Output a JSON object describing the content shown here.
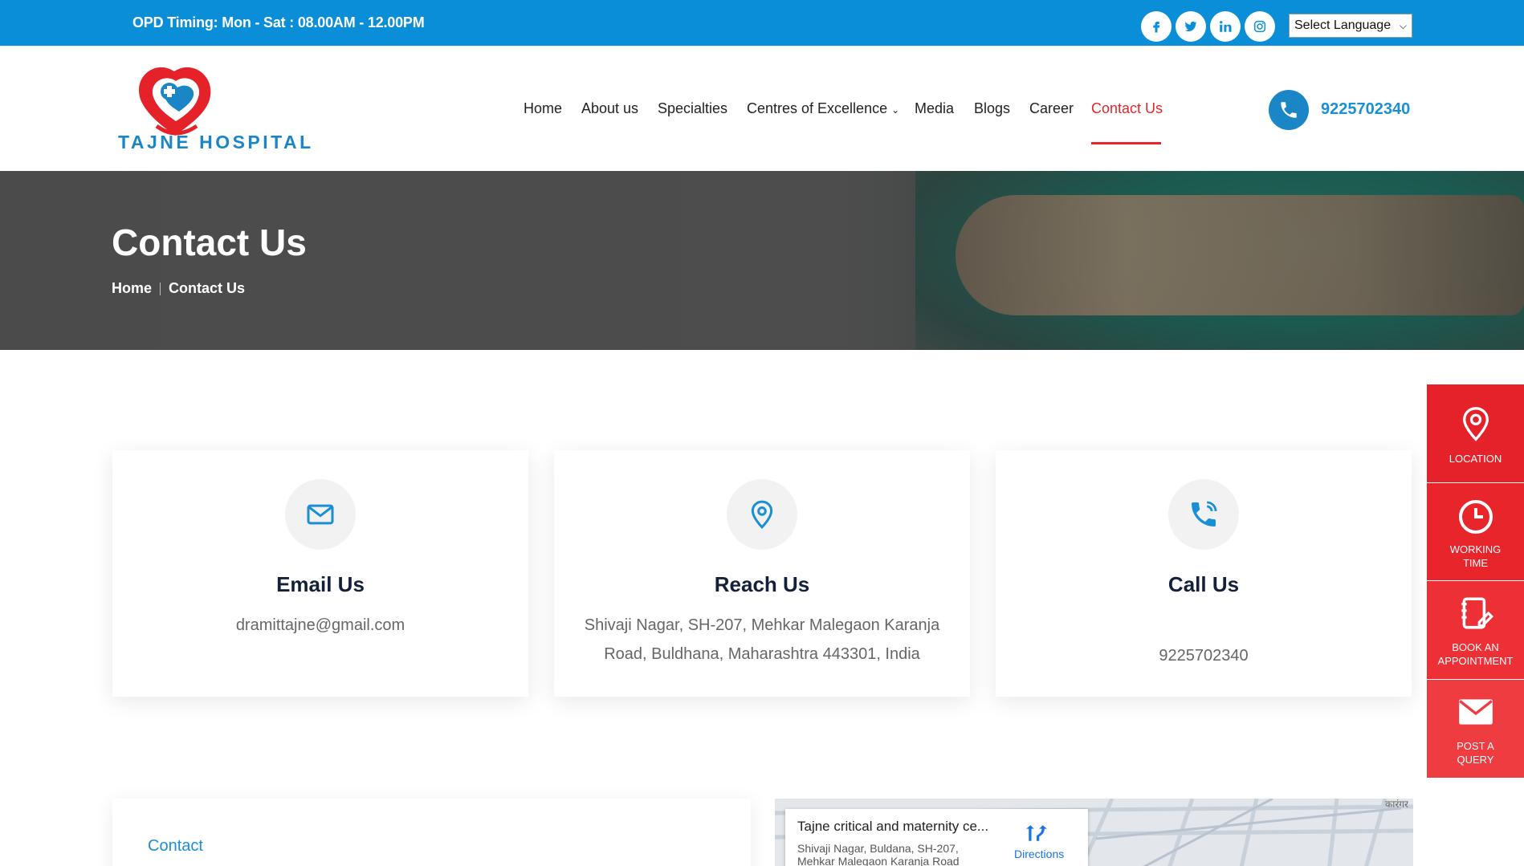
{
  "topbar": {
    "opd_timing": "OPD Timing: Mon - Sat : 08.00AM - 12.00PM",
    "social": [
      "facebook-icon",
      "twitter-icon",
      "linkedin-icon",
      "instagram-icon"
    ],
    "language_select": "Select Language"
  },
  "header": {
    "logo_text": "TAJNE HOSPITAL",
    "nav": [
      "Home",
      "About us",
      "Specialties",
      "Centres of Excellence",
      "Media",
      "Blogs",
      "Career",
      "Contact Us"
    ],
    "active_nav": "Contact Us",
    "phone": "9225702340"
  },
  "hero": {
    "title": "Contact Us",
    "breadcrumb": [
      "Home",
      "Contact Us"
    ]
  },
  "cards": [
    {
      "icon": "mail-icon",
      "title": "Email Us",
      "lines": [
        "dramittajne@gmail.com"
      ]
    },
    {
      "icon": "location-pin-icon",
      "title": "Reach Us",
      "lines": [
        "Shivaji Nagar, SH-207, Mehkar Malegaon Karanja",
        "Road, Buldhana, Maharashtra 443301, India"
      ]
    },
    {
      "icon": "phone-call-icon",
      "title": "Call Us",
      "lines": [
        "9225702340"
      ]
    }
  ],
  "side_buttons": [
    {
      "icon": "location-icon",
      "label": "LOCATION"
    },
    {
      "icon": "clock-icon",
      "label": "WORKING TIME"
    },
    {
      "icon": "appointment-book-icon",
      "label": "BOOK AN APPOINTMENT"
    },
    {
      "icon": "envelope-icon",
      "label": "POST A QUERY"
    }
  ],
  "form": {
    "tab_label": "Contact"
  },
  "map": {
    "place_name": "Tajne critical and maternity ce...",
    "address": "Shivaji Nagar, Buldana, SH-207, Mehkar Malegaon Karanja Road",
    "directions_label": "Directions",
    "map_label": "कारंगर"
  },
  "colors": {
    "brand_blue": "#0a8ed8",
    "accent_red": "#e5262a"
  }
}
